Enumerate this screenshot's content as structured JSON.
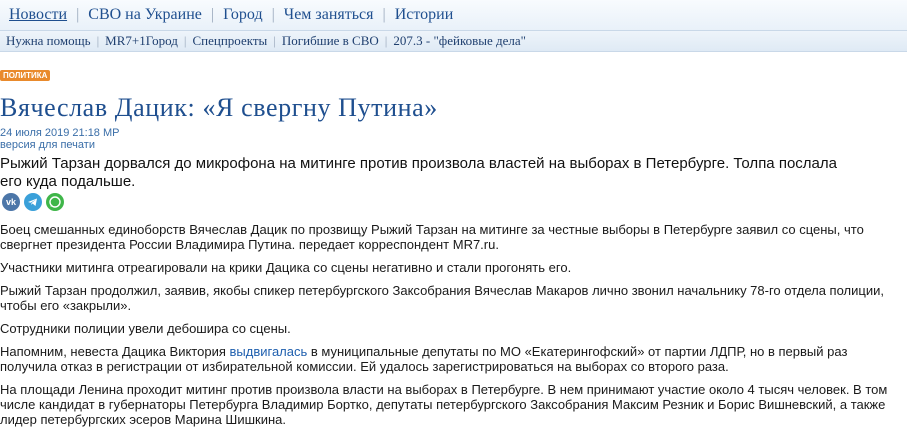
{
  "nav_primary": [
    "Новости",
    "СВО на Украине",
    "Город",
    "Чем заняться",
    "Истории"
  ],
  "nav_secondary": [
    "Нужна помощь",
    "MR7+1Город",
    "Спецпроекты",
    "Погибшие в СВО",
    "207.3 - \"фейковые дела\""
  ],
  "article": {
    "rubric": "ПОЛИТИКА",
    "title": "Вячеслав Дацик: «Я свергну Путина»",
    "date": "24 июля 2019 21:18 МР",
    "print_link": "версия для печати",
    "lead": "Рыжий Тарзан дорвался до микрофона на митинге против произвола властей на выборах в Петербурге. Толпа послала его куда подальше.",
    "share_icons": [
      "vk-icon",
      "telegram-icon",
      "whatsapp-icon"
    ],
    "paragraphs": {
      "p1": "Боец смешанных единоборств Вячеслав Дацик по прозвищу Рыжий Тарзан на митинге за честные выборы в Петербурге заявил со сцены, что свергнет президента России Владимира Путина. передает корреспондент MR7.ru.",
      "p2": "Участники митинга отреагировали на крики Дацика со сцены негативно и стали прогонять его.",
      "p3": "Рыжий Тарзан продолжил, заявив, якобы спикер петербургского Заксобрания Вячеслав Макаров лично звонил начальнику 78-го отдела полиции, чтобы его «закрыли».",
      "p4": "Сотрудники полиции увели дебошира со сцены.",
      "p5_before": "Напомним, невеста Дацика Виктория ",
      "p5_link": "выдвигалась",
      "p5_after": " в муниципальные депутаты по МО «Екатерингофский» от партии ЛДПР, но в первый раз получила отказ в регистрации от избирательной комиссии. Ей удалось зарегистрироваться на выборах со второго раза.",
      "p6": "На площади Ленина проходит митинг против произвола власти на выборах в Петербурге. В нем принимают участие около 4 тысяч человек. В том числе кандидат в губернаторы Петербурга Владимир Бортко, депутаты петербургского Заксобрания Максим Резник и Борис Вишневский, а также лидер петербургских эсеров Марина Шишкина."
    }
  },
  "colors": {
    "link": "#1f4f8f",
    "rubric": "#e98a2c"
  }
}
